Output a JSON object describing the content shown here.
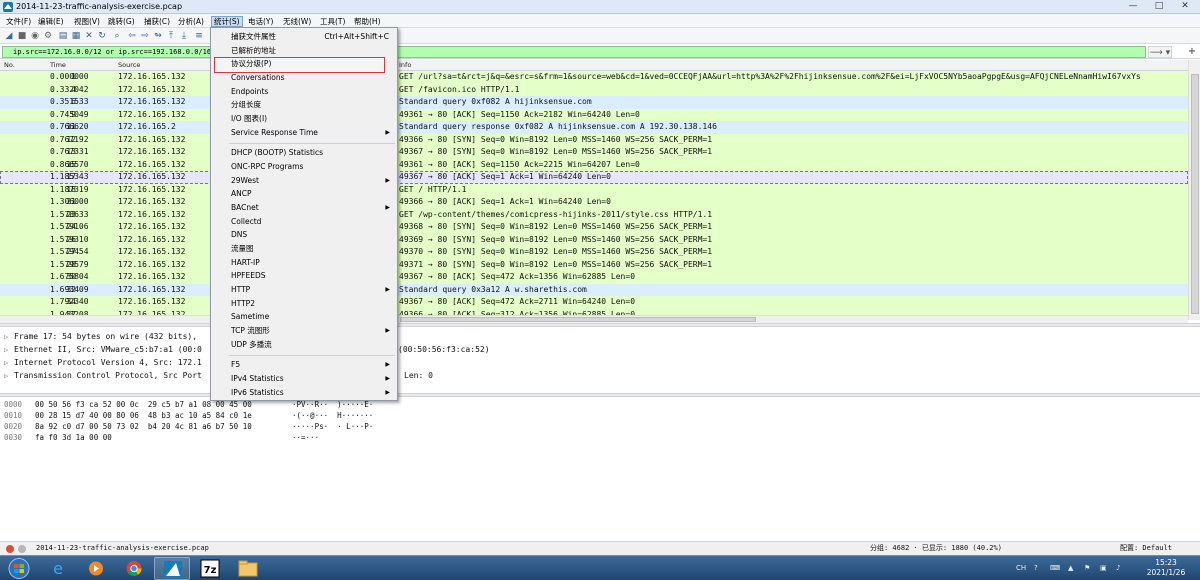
{
  "window": {
    "title": "2014-11-23-traffic-analysis-exercise.pcap",
    "controls": [
      "—",
      "□",
      "✕"
    ]
  },
  "menubar": [
    "文件(F)",
    "编辑(E)",
    "视图(V)",
    "跳转(G)",
    "捕获(C)",
    "分析(A)",
    "统计(S)",
    "电话(Y)",
    "无线(W)",
    "工具(T)",
    "帮助(H)"
  ],
  "filter": {
    "value": "ip.src==172.16.0.0/12 or ip.src==192.168.0.0/16",
    "arrow": "⟶ ▾",
    "plus": "+"
  },
  "columns": {
    "no": "No.",
    "time": "Time",
    "source": "Source",
    "info": "Info"
  },
  "colors": {
    "http_green": "#e4ffc7",
    "dns_blue": "#daeeff",
    "tcp_gray": "#e7e6ff",
    "filter_green": "#afffaf",
    "highlight_red": "#d23a3a"
  },
  "packets": [
    {
      "no": "1",
      "time": "0.000000",
      "src": "172.16.165.132",
      "info": "GET /url?sa=t&rct=j&q=&esrc=s&frm=1&source=web&cd=1&ved=0CCEQFjAA&url=http%3A%2F%2Fhijinksensue.com%2F&ei=LjFxVOC5NYb5aoaPgpgE&usg=AFQjCNELeNnamHiwI67vxYs",
      "color": "http"
    },
    {
      "no": "4",
      "time": "0.332042",
      "src": "172.16.165.132",
      "info": "GET /favicon.ico HTTP/1.1",
      "color": "http"
    },
    {
      "no": "6",
      "time": "0.351533",
      "src": "172.16.165.132",
      "info": "Standard query 0xf082 A hijinksensue.com",
      "color": "dns"
    },
    {
      "no": "9",
      "time": "0.745049",
      "src": "172.16.165.132",
      "info": "49361 → 80 [ACK] Seq=1150 Ack=2182 Win=64240 Len=0",
      "color": "http"
    },
    {
      "no": "11",
      "time": "0.766620",
      "src": "172.16.165.2",
      "info": "Standard query response 0xf082 A hijinksensue.com A 192.30.138.146",
      "color": "dns"
    },
    {
      "no": "12",
      "time": "0.767192",
      "src": "172.16.165.132",
      "info": "49366 → 80 [SYN] Seq=0 Win=8192 Len=0 MSS=1460 WS=256 SACK_PERM=1",
      "color": "http"
    },
    {
      "no": "13",
      "time": "0.767331",
      "src": "172.16.165.132",
      "info": "49367 → 80 [SYN] Seq=0 Win=8192 Len=0 MSS=1460 WS=256 SACK_PERM=1",
      "color": "http"
    },
    {
      "no": "15",
      "time": "0.866570",
      "src": "172.16.165.132",
      "info": "49361 → 80 [ACK] Seq=1150 Ack=2215 Win=64207 Len=0",
      "color": "http"
    },
    {
      "no": "17",
      "time": "1.185343",
      "src": "172.16.165.132",
      "info": "49367 → 80 [ACK] Seq=1 Ack=1 Win=64240 Len=0",
      "color": "tcp"
    },
    {
      "no": "18",
      "time": "1.187319",
      "src": "172.16.165.132",
      "info": "GET / HTTP/1.1",
      "color": "http"
    },
    {
      "no": "21",
      "time": "1.306000",
      "src": "172.16.165.132",
      "info": "49366 → 80 [ACK] Seq=1 Ack=1 Win=64240 Len=0",
      "color": "http"
    },
    {
      "no": "23",
      "time": "1.578633",
      "src": "172.16.165.132",
      "info": "GET /wp-content/themes/comicpress-hijinks-2011/style.css HTTP/1.1",
      "color": "http"
    },
    {
      "no": "24",
      "time": "1.579106",
      "src": "172.16.165.132",
      "info": "49368 → 80 [SYN] Seq=0 Win=8192 Len=0 MSS=1460 WS=256 SACK_PERM=1",
      "color": "http"
    },
    {
      "no": "26",
      "time": "1.579310",
      "src": "172.16.165.132",
      "info": "49369 → 80 [SYN] Seq=0 Win=8192 Len=0 MSS=1460 WS=256 SACK_PERM=1",
      "color": "http"
    },
    {
      "no": "27",
      "time": "1.579454",
      "src": "172.16.165.132",
      "info": "49370 → 80 [SYN] Seq=0 Win=8192 Len=0 MSS=1460 WS=256 SACK_PERM=1",
      "color": "http"
    },
    {
      "no": "28",
      "time": "1.579579",
      "src": "172.16.165.132",
      "info": "49371 → 80 [SYN] Seq=0 Win=8192 Len=0 MSS=1460 WS=256 SACK_PERM=1",
      "color": "http"
    },
    {
      "no": "30",
      "time": "1.675804",
      "src": "172.16.165.132",
      "info": "49367 → 80 [ACK] Seq=472 Ack=1356 Win=62885 Len=0",
      "color": "http"
    },
    {
      "no": "32",
      "time": "1.693409",
      "src": "172.16.165.132",
      "info": "Standard query 0x3a12 A w.sharethis.com",
      "color": "dns"
    },
    {
      "no": "34",
      "time": "1.792340",
      "src": "172.16.165.132",
      "info": "49367 → 80 [ACK] Seq=472 Ack=2711 Win=64240 Len=0",
      "color": "http"
    },
    {
      "no": "37",
      "time": "1.943208",
      "src": "172.16.165.132",
      "info": "49366 → 80 [ACK] Seq=312 Ack=1356 Win=62885 Len=0",
      "color": "http"
    }
  ],
  "details": [
    {
      "head": "Frame 17: 54 bytes on wire (432 bits),",
      "tail": ""
    },
    {
      "head": "Ethernet II, Src: VMware_c5:b7:a1 (00:0",
      "tail": "(00:50:56:f3:ca:52)"
    },
    {
      "head": "Internet Protocol Version 4, Src: 172.1",
      "tail": ""
    },
    {
      "head": "Transmission Control Protocol, Src Port",
      "tail": "Len: 0"
    }
  ],
  "bytes": [
    {
      "off": "0000",
      "hex": "00 50 56 f3 ca 52 00 0c  29 c5 b7 a1 08 00 45 00",
      "ascii": "·PV··R··  )·····E·"
    },
    {
      "off": "0010",
      "hex": "00 28 15 d7 40 00 80 06  48 b3 ac 10 a5 84 c0 1e",
      "ascii": "·(··@···  H·······"
    },
    {
      "off": "0020",
      "hex": "8a 92 c0 d7 00 50 73 02  b4 20 4c 81 a6 b7 50 10",
      "ascii": "·····Ps·  · L···P·"
    },
    {
      "off": "0030",
      "hex": "fa f0 3d 1a 00 00",
      "ascii": "··=···"
    }
  ],
  "statusbar": {
    "file": "2014-11-23-traffic-analysis-exercise.pcap",
    "counts": "分组: 4682 · 已显示: 1880 (40.2%)",
    "profile": "配置: Default"
  },
  "statsmenu": {
    "items": [
      {
        "label": "捕获文件属性",
        "shortcut": "Ctrl+Alt+Shift+C"
      },
      {
        "label": "已解析的地址"
      },
      {
        "label": "协议分级(P)",
        "highlighted": true
      },
      {
        "label": "Conversations"
      },
      {
        "label": "Endpoints"
      },
      {
        "label": "分组长度"
      },
      {
        "label": "I/O 图表(I)"
      },
      {
        "label": "Service Response Time",
        "submenu": true
      },
      {
        "sep": true
      },
      {
        "label": "DHCP (BOOTP) Statistics"
      },
      {
        "label": "ONC-RPC Programs"
      },
      {
        "label": "29West",
        "submenu": true
      },
      {
        "label": "ANCP"
      },
      {
        "label": "BACnet",
        "submenu": true
      },
      {
        "label": "Collectd"
      },
      {
        "label": "DNS"
      },
      {
        "label": "流量图"
      },
      {
        "label": "HART-IP"
      },
      {
        "label": "HPFEEDS"
      },
      {
        "label": "HTTP",
        "submenu": true
      },
      {
        "label": "HTTP2"
      },
      {
        "label": "Sametime"
      },
      {
        "label": "TCP 流图形",
        "submenu": true
      },
      {
        "label": "UDP 多播流"
      },
      {
        "sep": true
      },
      {
        "label": "F5",
        "submenu": true
      },
      {
        "label": "IPv4 Statistics",
        "submenu": true
      },
      {
        "label": "IPv6 Statistics",
        "submenu": true
      }
    ]
  },
  "taskbar": {
    "apps": [
      "start-orb",
      "ie",
      "media-player",
      "chrome",
      "wireshark",
      "7zip",
      "explorer"
    ],
    "lang": "CH",
    "time": "15:23",
    "date": "2021/1/26"
  }
}
